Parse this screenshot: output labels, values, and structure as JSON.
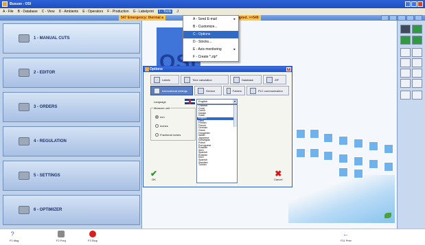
{
  "window": {
    "title": "Bususe - OSI",
    "brand_colors": {
      "titlebar": "#2d63d6",
      "panel": "#bfd2ec",
      "accent": "#316ac5",
      "alert": "#f3c84e"
    }
  },
  "menubar": {
    "items": [
      "A - File",
      "B - Database",
      "C - View",
      "D - Ambients",
      "E - Operators",
      "F - Production",
      "G - Labelprint",
      "I - Tools",
      "J"
    ]
  },
  "status": {
    "message": "547 Emergency: thermal a",
    "message_tail": "upted. >>549"
  },
  "tools_menu": {
    "items": [
      {
        "label": "A - Send E-mail",
        "submenu": true
      },
      {
        "label": "B - Customize...",
        "submenu": false
      },
      {
        "label": "C - Options",
        "submenu": false,
        "active": true
      },
      {
        "label": "D - Stocks...",
        "submenu": false
      },
      {
        "label": "E - Axis monitoring",
        "submenu": true
      },
      {
        "label": "F - Create *.zip*",
        "submenu": false
      }
    ]
  },
  "nav": {
    "items": [
      {
        "label": "1 - MANUAL CUTS"
      },
      {
        "label": "2 - EDITOR"
      },
      {
        "label": "3 - ORDERS"
      },
      {
        "label": "4 - REGULATION"
      },
      {
        "label": "5 - SETTINGS"
      },
      {
        "label": "6 - OPTIMIZER"
      }
    ]
  },
  "logo": {
    "text": "OSI"
  },
  "options_dialog": {
    "title": "Options",
    "tabs_row1": [
      "Labels",
      "Time calculation",
      "Database",
      "ZIP"
    ],
    "tabs_row2": [
      "International settings",
      "Service",
      "Folders",
      "PLC communication"
    ],
    "language_label": "Language",
    "language_value": "English",
    "measure_title": "Measure unit",
    "measure_options": [
      "mm",
      "Inches",
      "Fractional inches"
    ],
    "measure_selected": "mm",
    "language_list": [
      "Chinese",
      "Croat",
      "Czech",
      "Danish",
      "Dutch",
      "English",
      "Farsi",
      "Finnish",
      "French",
      "German",
      "Greek",
      "Hungarian",
      "Italian",
      "Japanese",
      "Norwegian",
      "Polish",
      "Portuguese",
      "Russian",
      "Serb",
      "Spanish",
      "Russian",
      "Serb",
      "Spanish",
      "Swedish",
      "Turkish"
    ],
    "language_selected": "English",
    "ok_label": "OK",
    "cancel_label": "Cancel"
  },
  "bottom": {
    "f1": "F1 Msg",
    "f2": "F2 Freq",
    "f3": "F3 Stop",
    "f11": "F11 Prev"
  }
}
